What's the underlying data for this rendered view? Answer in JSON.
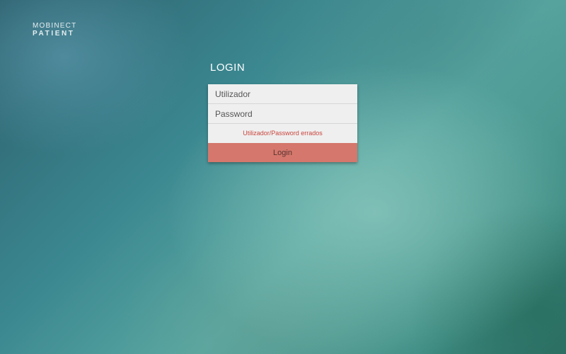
{
  "brand": {
    "line1": "MOBINECT",
    "line2": "PATIENT"
  },
  "login": {
    "title": "LOGIN",
    "username_placeholder": "Utilizador",
    "password_placeholder": "Password",
    "error_message": "Utilizador/Password errados",
    "submit_label": "Login"
  },
  "colors": {
    "button_background": "#d5776c",
    "error_text": "#c9463e",
    "card_background": "#efefef"
  }
}
